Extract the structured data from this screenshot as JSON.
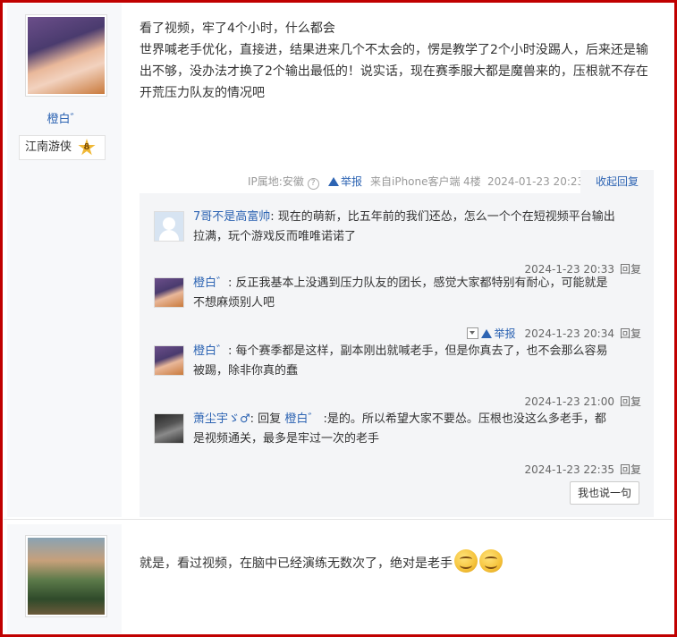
{
  "post1": {
    "author": "橙白゛",
    "badge": {
      "title": "江南游侠",
      "level": "8"
    },
    "lines": [
      "看了视频，牢了4个小时，什么都会",
      "世界喊老手优化，直接进，结果进来几个不太会的，愣是教学了2个小时没踢人，后来还是输",
      "出不够，没办法才换了2个输出最低的！说实话，现在赛季服大都是魔兽来的，压根就不存在",
      "开荒压力队友的情况吧"
    ],
    "meta": {
      "ip": "IP属地:安徽",
      "help_icon": "?",
      "report": "举报",
      "source": "来自iPhone客户端",
      "floor": "4楼",
      "time": "2024-01-23 20:23",
      "collapse": "收起回复"
    },
    "replies": [
      {
        "name": "7哥不是高富帅",
        "lines": [
          "现在的萌新，比五年前的我们还怂，怎么一个个在短视频平台输出",
          "拉满，玩个游戏反而唯唯诺诺了"
        ],
        "time": "2024-1-23 20:33",
        "reply_label": "回复"
      },
      {
        "name": "橙白゛",
        "lines": [
          "反正我基本上没遇到压力队友的团长，感觉大家都特别有耐心，可能就是",
          "不想麻烦别人吧"
        ],
        "report": "举报",
        "time": "2024-1-23 20:34",
        "reply_label": "回复"
      },
      {
        "name": "橙白゛",
        "lines": [
          "每个赛季都是这样，副本刚出就喊老手，但是你真去了，也不会那么容易",
          "被踢，除非你真的蠢"
        ],
        "time": "2024-1-23 21:00",
        "reply_label": "回复"
      },
      {
        "name": "萧尘宇ゞ♂",
        "reply_prefix": "回复",
        "reply_to": "橙白゛",
        "lines": [
          "是的。所以希望大家不要怂。压根也没这么多老手，都",
          "是视频通关，最多是牢过一次的老手"
        ],
        "time": "2024-1-23 22:35",
        "reply_label": "回复"
      }
    ],
    "say_button": "我也说一句"
  },
  "post2": {
    "text": "就是，看过视频，在脑中已经演练无数次了，绝对是老手"
  }
}
